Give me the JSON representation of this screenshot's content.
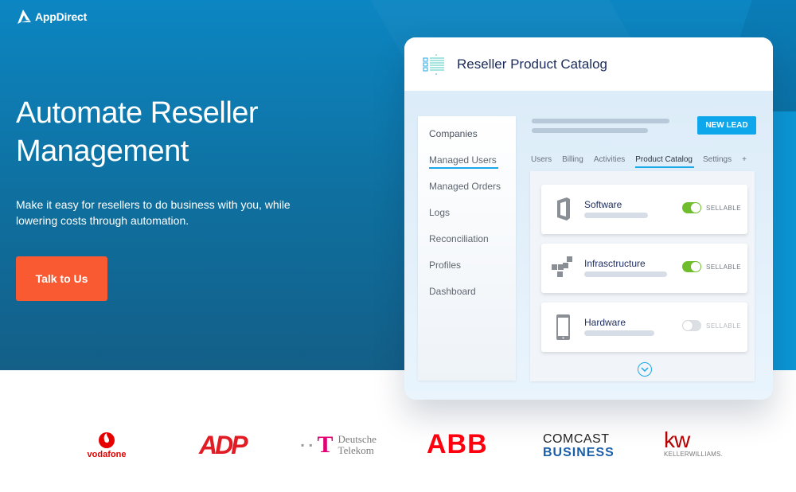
{
  "brand": {
    "name": "AppDirect",
    "icon": "appdirect-logo-icon"
  },
  "hero": {
    "headline": "Automate Reseller Management",
    "headline_lines": [
      "Automate Reseller",
      "Management"
    ],
    "subtext": "Make it easy for resellers to do business with you, while lowering costs through automation.",
    "cta_label": "Talk to Us",
    "colors": {
      "background": "#0c86c2",
      "cta": "#fa5a32"
    }
  },
  "mockup": {
    "title": "Reseller Product Catalog",
    "title_icon": "catalog-list-icon",
    "new_lead_label": "NEW LEAD",
    "sidebar": {
      "items": [
        {
          "label": "Companies",
          "active": true
        },
        {
          "label": "Managed Users"
        },
        {
          "label": "Managed Orders"
        },
        {
          "label": "Logs"
        },
        {
          "label": "Reconciliation"
        },
        {
          "label": "Profiles"
        },
        {
          "label": "Dashboard"
        }
      ]
    },
    "tabs": [
      {
        "label": "Users"
      },
      {
        "label": "Billing"
      },
      {
        "label": "Activities"
      },
      {
        "label": "Product Catalog",
        "active": true
      },
      {
        "label": "Settings"
      },
      {
        "label": "+"
      }
    ],
    "products": [
      {
        "name": "Software",
        "icon": "office-document-icon",
        "sellable": true,
        "status_label": "SELLABLE"
      },
      {
        "name": "Infrasctructure",
        "icon": "cubes-icon",
        "sellable": true,
        "status_label": "SELLABLE"
      },
      {
        "name": "Hardware",
        "icon": "smartphone-icon",
        "sellable": false,
        "status_label": "SELLABLE"
      }
    ],
    "colors": {
      "accent": "#1aa8e8",
      "toggle_on": "#6fbc2c"
    }
  },
  "customers": {
    "logos": [
      {
        "name": "vodafone",
        "text": "vodafone",
        "color": "#e60000"
      },
      {
        "name": "adp",
        "text": "ADP",
        "color": "#e21c24"
      },
      {
        "name": "deutsche-telekom",
        "text_lines": [
          "Deutsche",
          "Telekom"
        ],
        "color": "#e20074"
      },
      {
        "name": "abb",
        "text": "ABB",
        "color": "#ff000f"
      },
      {
        "name": "comcast-business",
        "text_lines": [
          "COMCAST",
          "BUSINESS"
        ],
        "color": "#1a5fa8"
      },
      {
        "name": "keller-williams",
        "text": "kw",
        "sub": "KELLERWILLIAMS.",
        "color": "#b40101"
      }
    ]
  }
}
